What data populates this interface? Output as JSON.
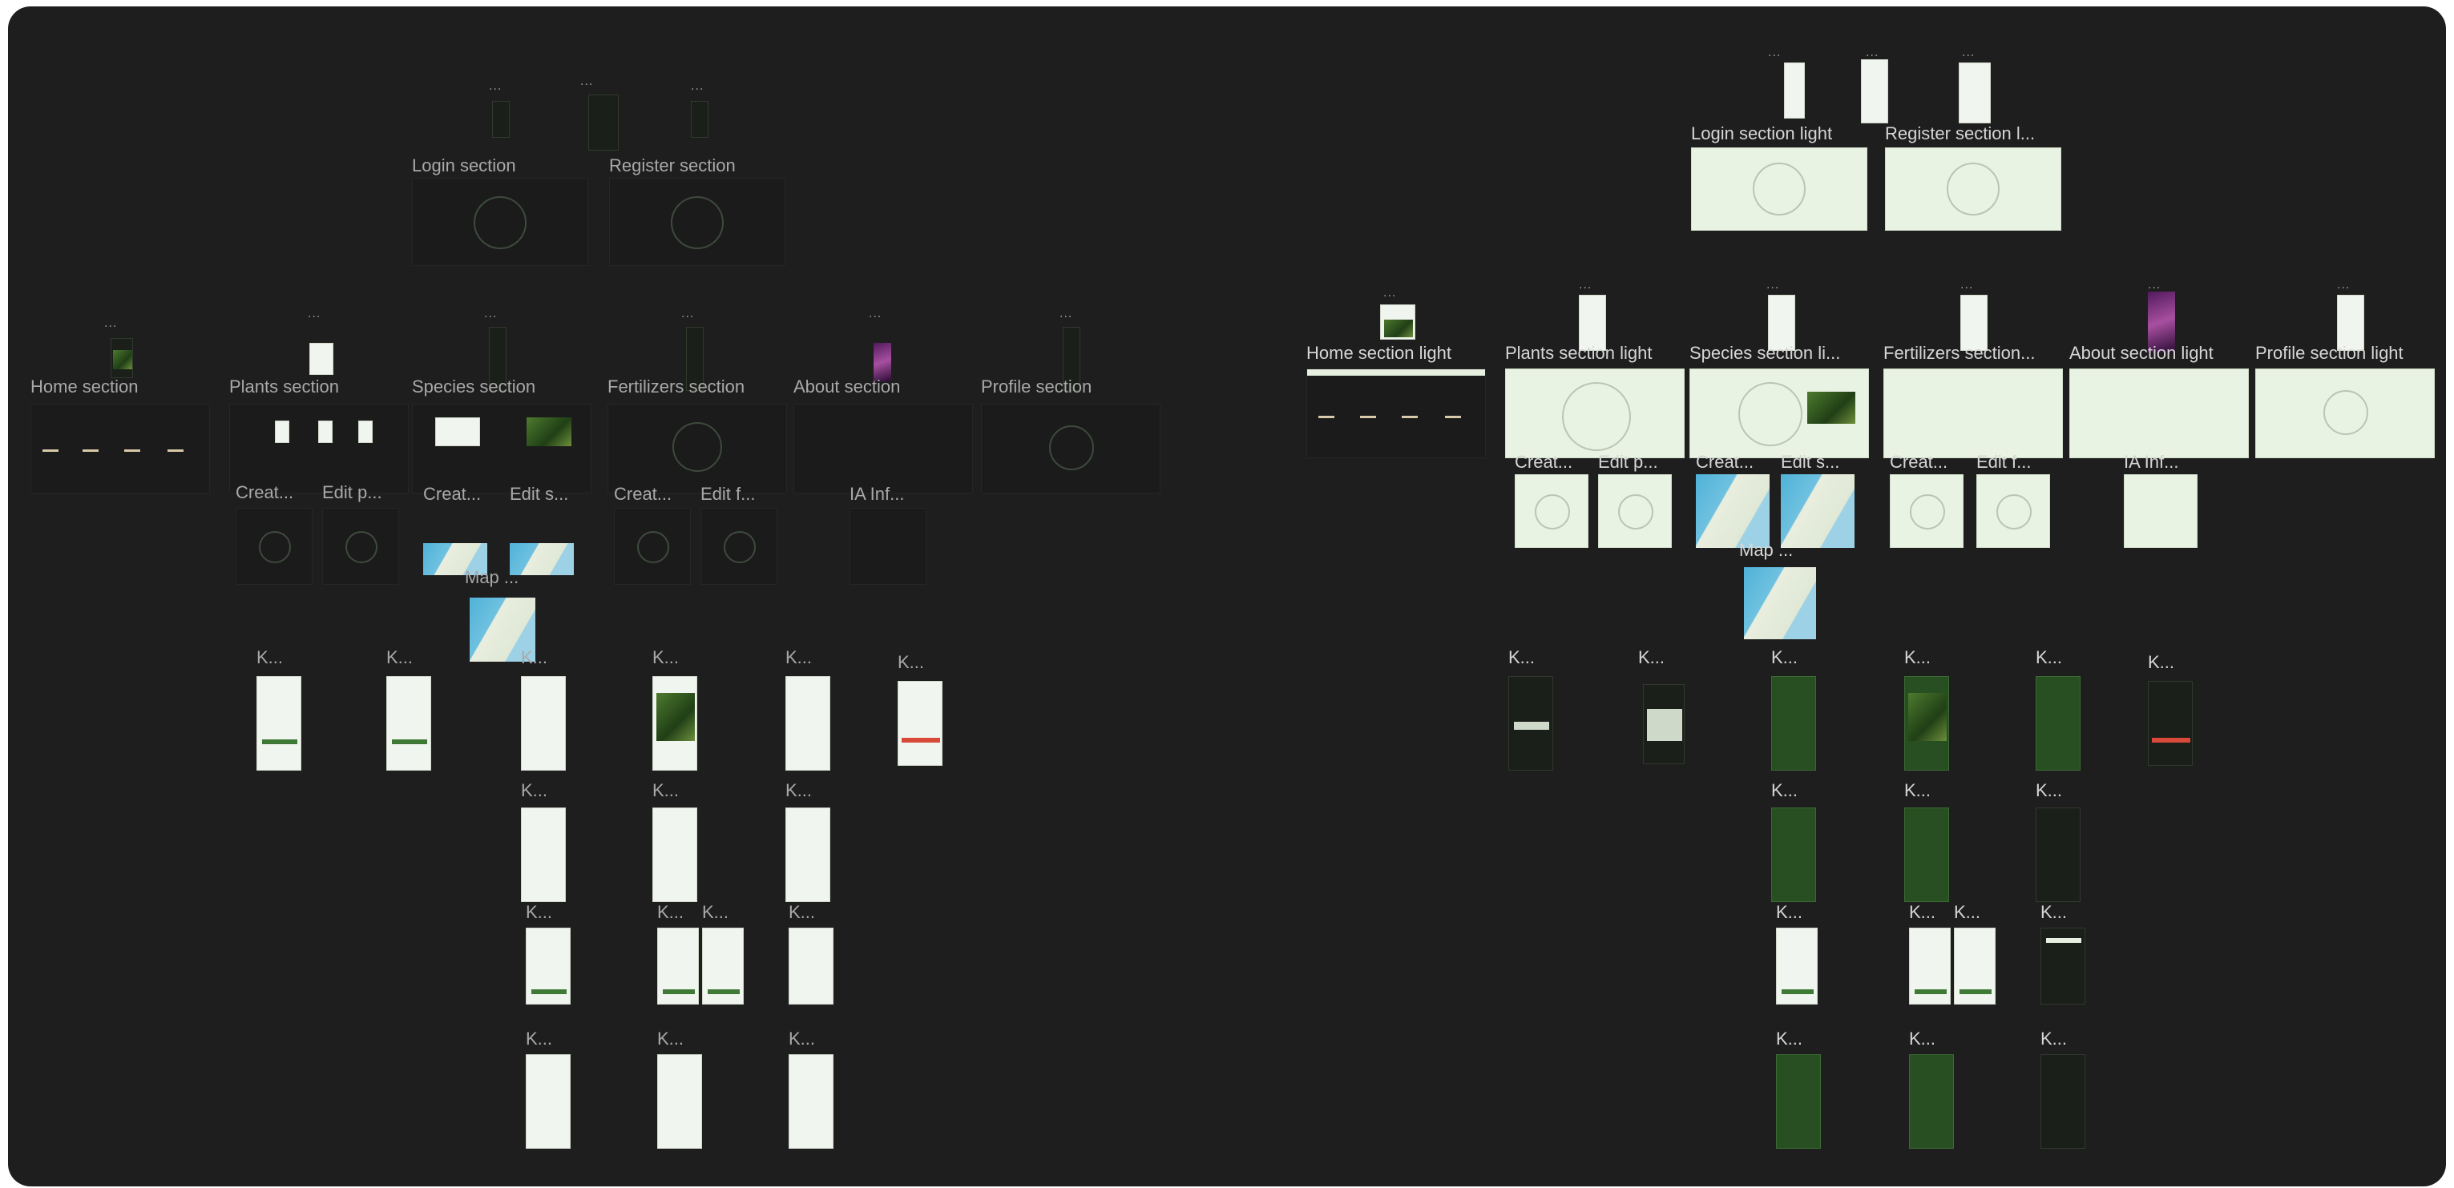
{
  "canvas": {
    "background": "#1e1e1e",
    "accent_green": "#3e7a35",
    "light_frame": "#e9f3e3"
  },
  "dark_flow": {
    "login_label": "Login section",
    "register_label": "Register section",
    "home_label": "Home section",
    "plants_label": "Plants section",
    "species_label": "Species section",
    "fertilizers_label": "Fertilizers section",
    "about_label": "About section",
    "profile_label": "Profile section",
    "create_plant_label": "Creat...",
    "edit_plant_label": "Edit p...",
    "create_species_label": "Creat...",
    "edit_species_label": "Edit s...",
    "create_fert_label": "Creat...",
    "edit_fert_label": "Edit f...",
    "ia_label": "IA Inf...",
    "map_label": "Map ...",
    "k_labels": [
      "K...",
      "K...",
      "K...",
      "K...",
      "K...",
      "K...",
      "K...",
      "K...",
      "K...",
      "K...",
      "K...",
      "K...",
      "K...",
      "K...",
      "K...",
      "K..."
    ]
  },
  "light_flow": {
    "login_label": "Login section light",
    "register_label": "Register section l...",
    "home_label": "Home section light",
    "plants_label": "Plants section light",
    "species_label": "Species section li...",
    "fertilizers_label": "Fertilizers section...",
    "about_label": "About section light",
    "profile_label": "Profile section light",
    "create_plant_label": "Creat...",
    "edit_plant_label": "Edit p...",
    "create_species_label": "Creat...",
    "edit_species_label": "Edit s...",
    "create_fert_label": "Creat...",
    "edit_fert_label": "Edit f...",
    "ia_label": "IA Inf...",
    "map_label": "Map ...",
    "k_labels": [
      "K...",
      "K...",
      "K...",
      "K...",
      "K...",
      "K...",
      "K...",
      "K...",
      "K...",
      "K...",
      "K...",
      "K...",
      "K...",
      "K...",
      "K...",
      "K..."
    ]
  },
  "dots": "..."
}
